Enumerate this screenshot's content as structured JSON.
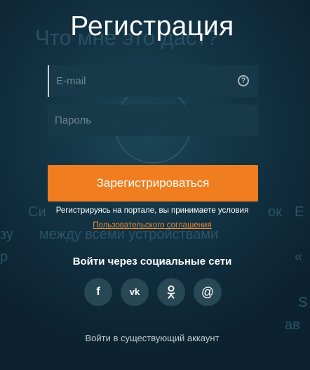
{
  "background": {
    "headline": "Что мне это даст?",
    "line_left_1": "Си",
    "line_left_2": "между всеми устройствами",
    "line_left_3": "зу",
    "line_left_4": "р",
    "line_right_1": "ок",
    "line_right_2": "Е",
    "line_right_3": "«",
    "line_right_4": "S",
    "line_right_5": "ав"
  },
  "form": {
    "title": "Регистрация",
    "email_placeholder": "E-mail",
    "password_placeholder": "Пароль",
    "help_glyph": "?",
    "submit_label": "Зарегистрироваться"
  },
  "terms": {
    "text": "Регистрируясь на портале, вы принимаете условия",
    "link": "Пользовательского соглашения"
  },
  "social": {
    "title": "Войти через социальные сети",
    "buttons": [
      {
        "name": "facebook",
        "glyph": "f"
      },
      {
        "name": "vk",
        "glyph": "vk"
      },
      {
        "name": "odnoklassniki",
        "glyph": "ok"
      },
      {
        "name": "mail",
        "glyph": "@"
      }
    ]
  },
  "footer": {
    "login_link": "Войти в существующий аккаунт"
  },
  "colors": {
    "accent": "#f07d1f",
    "link": "#f08a35",
    "background": "#133445"
  }
}
